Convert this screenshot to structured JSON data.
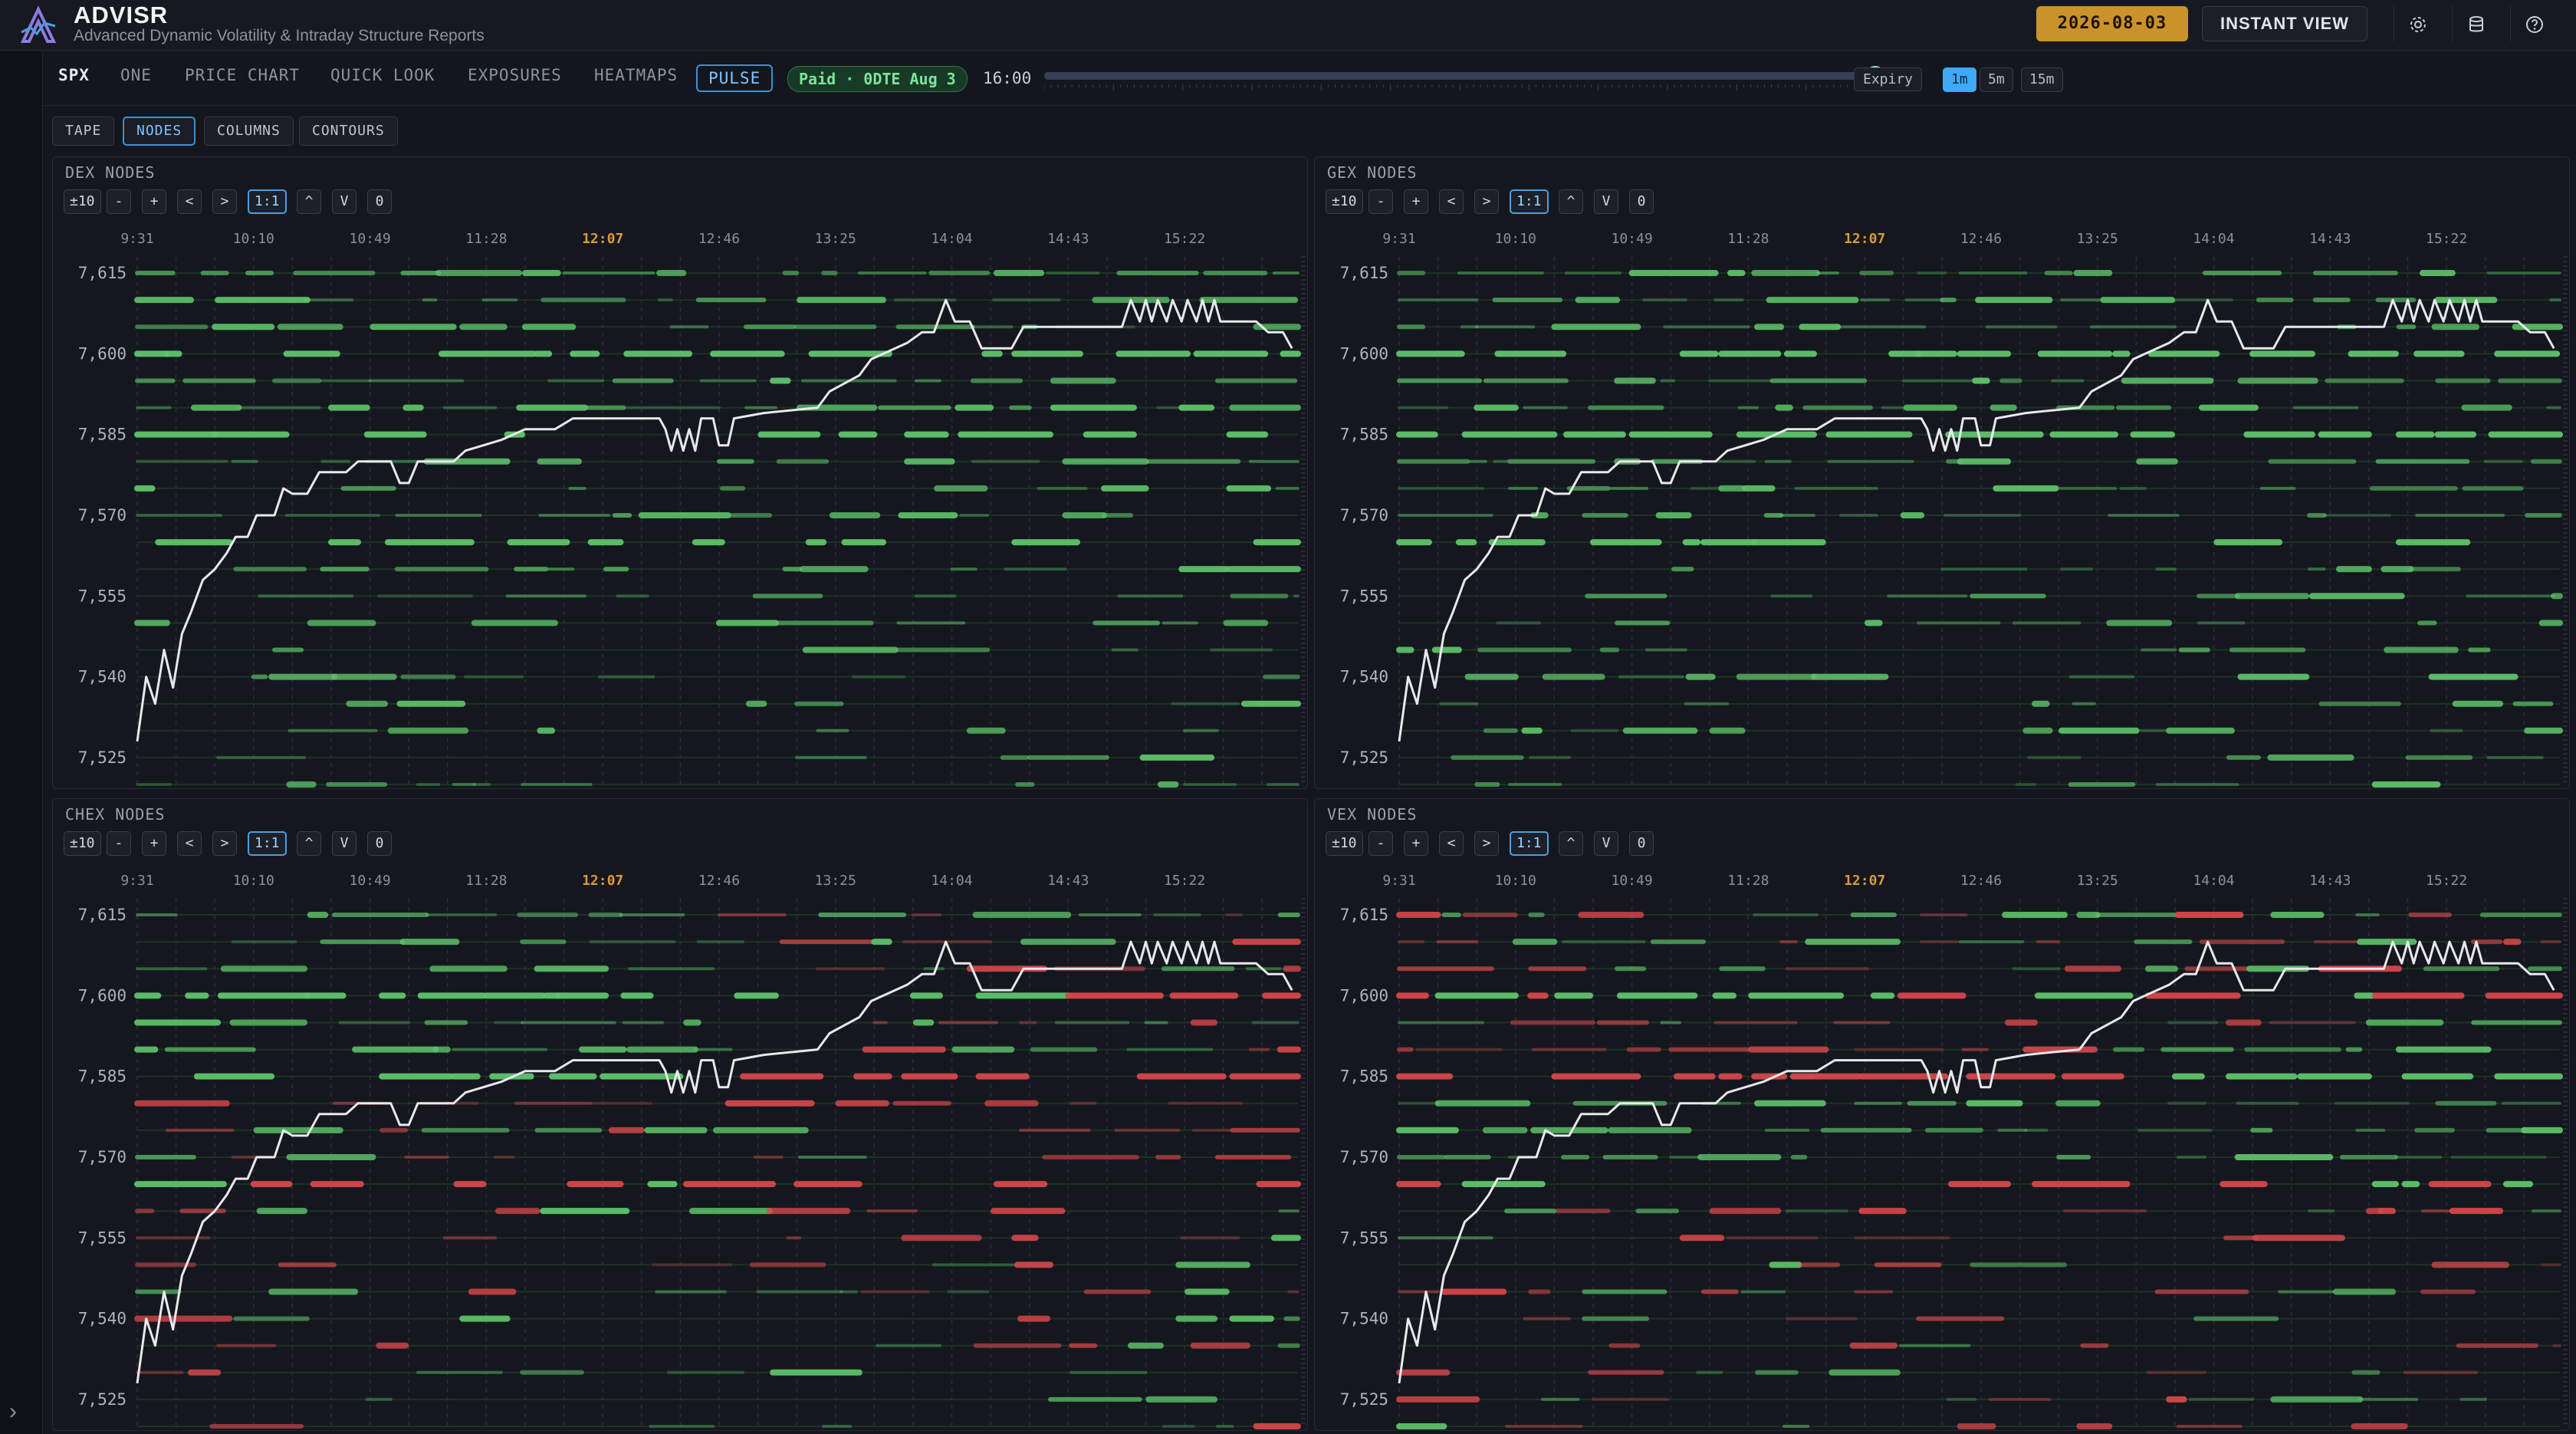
{
  "app": {
    "title": "ADVISR",
    "subtitle": "Advanced Dynamic Volatility & Intraday Structure Reports",
    "date": "2026-08-03",
    "instant_view": "INSTANT VIEW"
  },
  "nav": {
    "symbol": "SPX",
    "tabs": [
      "ONE",
      "PRICE CHART",
      "QUICK LOOK",
      "EXPOSURES",
      "HEATMAPS",
      "PULSE"
    ],
    "active_tab": "PULSE",
    "paid_badge": "Paid · 0DTE Aug 3",
    "time": "16:00",
    "slider_fraction": 1.0,
    "expiry": "Expiry",
    "timeframes": [
      "1m",
      "5m",
      "15m"
    ],
    "active_timeframe": "1m"
  },
  "subtabs": {
    "items": [
      "TAPE",
      "NODES",
      "COLUMNS",
      "CONTOURS"
    ],
    "active": "NODES"
  },
  "controls": [
    "±10",
    "-",
    "+",
    "<",
    ">",
    "1:1",
    "^",
    "V",
    "0"
  ],
  "colors": {
    "positive": "#5ec46a",
    "negative": "#d6474a",
    "price_line": "#e8e8ec",
    "highlight_time": "#d79a3a",
    "accent": "#3fa9f5"
  },
  "chart_data": [
    {
      "type": "heatmap",
      "title": "DEX NODES"
    },
    {
      "type": "heatmap",
      "title": "GEX NODES"
    },
    {
      "type": "heatmap",
      "title": "CHEX NODES"
    },
    {
      "type": "heatmap",
      "title": "VEX NODES"
    }
  ],
  "axes": {
    "times": [
      "9:31",
      "10:10",
      "10:49",
      "11:28",
      "12:07",
      "12:46",
      "13:25",
      "14:04",
      "14:43",
      "15:22"
    ],
    "highlight_time": "12:07",
    "y_ticks": [
      "7,615",
      "7,600",
      "7,585",
      "7,570",
      "7,555",
      "7,540",
      "7,525"
    ],
    "y_values": [
      7615,
      7600,
      7585,
      7570,
      7555,
      7540,
      7525
    ],
    "y_range": [
      7520,
      7618
    ],
    "strike_step": 5,
    "session_minutes": [
      0,
      389
    ]
  },
  "price_path": [
    [
      0,
      7528
    ],
    [
      3,
      7540
    ],
    [
      6,
      7535
    ],
    [
      9,
      7545
    ],
    [
      12,
      7538
    ],
    [
      15,
      7548
    ],
    [
      18,
      7552
    ],
    [
      22,
      7558
    ],
    [
      26,
      7560
    ],
    [
      30,
      7563
    ],
    [
      33,
      7566
    ],
    [
      37,
      7566
    ],
    [
      40,
      7570
    ],
    [
      46,
      7570
    ],
    [
      49,
      7575
    ],
    [
      52,
      7574
    ],
    [
      57,
      7574
    ],
    [
      61,
      7578
    ],
    [
      70,
      7578
    ],
    [
      74,
      7580
    ],
    [
      85,
      7580
    ],
    [
      88,
      7576
    ],
    [
      91,
      7576
    ],
    [
      94,
      7580
    ],
    [
      106,
      7580
    ],
    [
      110,
      7582
    ],
    [
      122,
      7584
    ],
    [
      130,
      7586
    ],
    [
      140,
      7586
    ],
    [
      146,
      7588
    ],
    [
      175,
      7588
    ],
    [
      177,
      7586
    ],
    [
      179,
      7582
    ],
    [
      181,
      7586
    ],
    [
      183,
      7582
    ],
    [
      185,
      7586
    ],
    [
      187,
      7582
    ],
    [
      189,
      7588
    ],
    [
      193,
      7588
    ],
    [
      195,
      7583
    ],
    [
      198,
      7583
    ],
    [
      200,
      7588
    ],
    [
      210,
      7589
    ],
    [
      228,
      7590
    ],
    [
      232,
      7593
    ],
    [
      242,
      7596
    ],
    [
      246,
      7599
    ],
    [
      254,
      7601
    ],
    [
      258,
      7602
    ],
    [
      263,
      7604
    ],
    [
      267,
      7604
    ],
    [
      271,
      7610
    ],
    [
      274,
      7606
    ],
    [
      279,
      7606
    ],
    [
      283,
      7601
    ],
    [
      293,
      7601
    ],
    [
      297,
      7605
    ],
    [
      330,
      7605
    ],
    [
      333,
      7610
    ],
    [
      336,
      7606
    ],
    [
      338,
      7610
    ],
    [
      340,
      7606
    ],
    [
      342,
      7610
    ],
    [
      345,
      7606
    ],
    [
      347,
      7610
    ],
    [
      350,
      7606
    ],
    [
      352,
      7610
    ],
    [
      355,
      7606
    ],
    [
      357,
      7610
    ],
    [
      359,
      7606
    ],
    [
      361,
      7610
    ],
    [
      363,
      7606
    ],
    [
      375,
      7606
    ],
    [
      379,
      7604
    ],
    [
      384,
      7604
    ],
    [
      387,
      7601
    ]
  ]
}
